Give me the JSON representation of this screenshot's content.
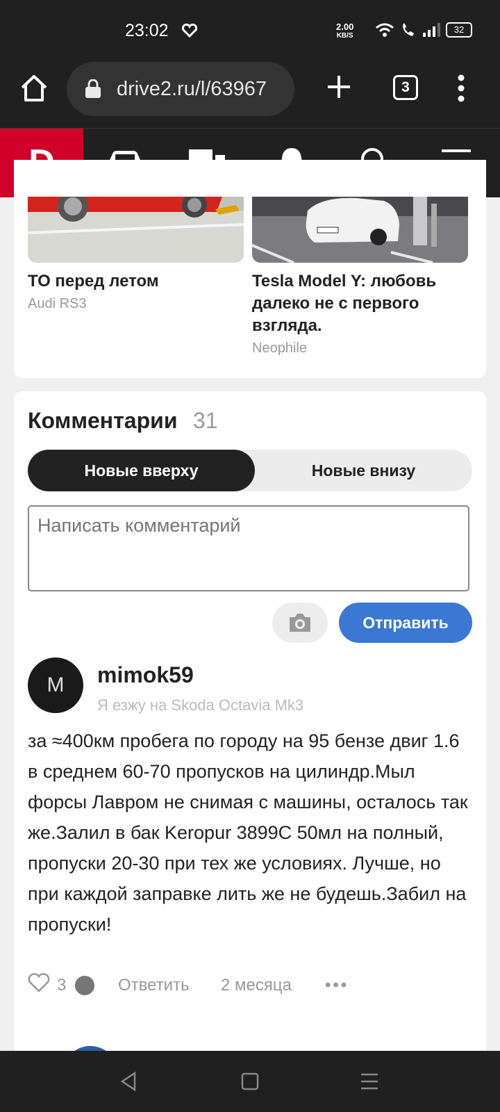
{
  "status": {
    "time": "23:02",
    "speed_value": "2.00",
    "speed_unit": "KB/S",
    "battery": "32"
  },
  "browser": {
    "url": "drive2.ru/l/63967",
    "tab_count": "3"
  },
  "site": {
    "logo": "D"
  },
  "articles": [
    {
      "title": "ТО перед летом",
      "author": "Audi RS3"
    },
    {
      "title": "Tesla Model Y: любовь далеко не с первого взгляда.",
      "author": "Neophile"
    }
  ],
  "comments": {
    "title": "Комментарии",
    "count": "31",
    "sort_newest": "Новые вверху",
    "sort_oldest": "Новые внизу",
    "placeholder": "Написать комментарий",
    "send_label": "Отправить",
    "items": [
      {
        "avatar_letter": "M",
        "username": "mimok59",
        "car": "Я езжу на Skoda Octavia Mk3",
        "text": "за ≈400км пробега по городу на 95 бензе двиг 1.6 в среднем 60-70 пропусков на цилиндр.Мыл форсы Лавром не снимая с машины, осталось так же.Залил в бак Keropur 3899C 50мл на полный, пропуски 20-30 при тех же условиях. Лучше, но при каждой заправке лить же не будешь.Забил на пропуски!",
        "likes": "3",
        "reply_label": "Ответить",
        "age": "2 месяца",
        "more": "•••"
      }
    ]
  }
}
